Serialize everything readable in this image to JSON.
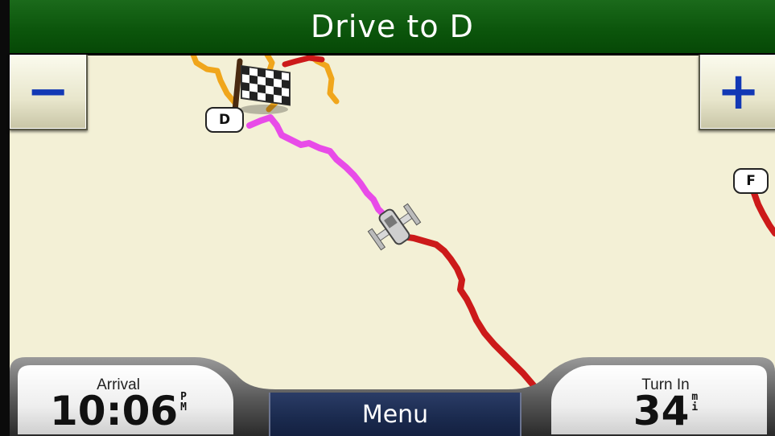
{
  "title_bar": {
    "title": "Drive to D"
  },
  "zoom": {
    "out_label": "−",
    "in_label": "+"
  },
  "map": {
    "badges": {
      "destination": "D",
      "side": "F"
    },
    "colors": {
      "background": "#f3f0d6",
      "active_route": "#e84be8",
      "road": "#cc1a1a",
      "trail": "#f0a61c"
    },
    "icons": [
      "checkered-flag-icon",
      "vehicle-icon"
    ]
  },
  "bottom_bar": {
    "arrival": {
      "label": "Arrival",
      "value": "10:06",
      "unit_top": "P",
      "unit_bottom": "M"
    },
    "menu": {
      "label": "Menu"
    },
    "turn_in": {
      "label": "Turn In",
      "value": "34",
      "unit_top": "m",
      "unit_bottom": "i"
    }
  }
}
